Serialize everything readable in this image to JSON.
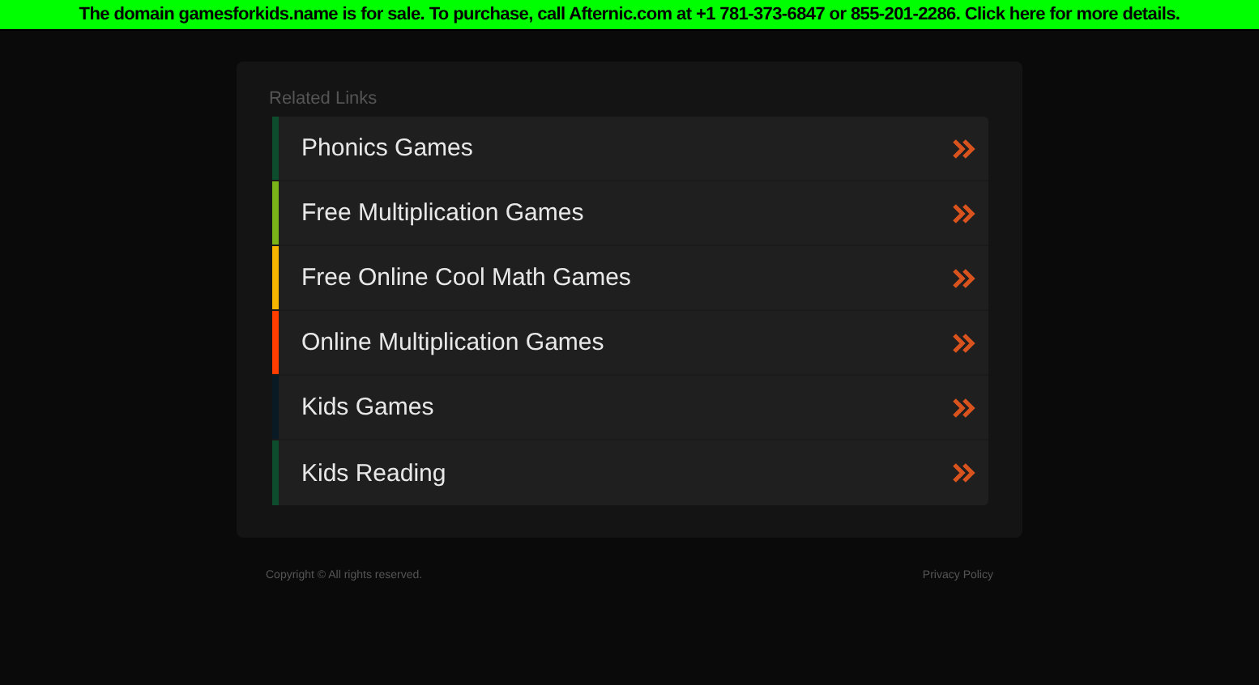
{
  "banner": {
    "text": "The domain gamesforkids.name is for sale. To purchase, call Afternic.com at +1 781-373-6847 or 855-201-2286. Click here for more details."
  },
  "panel": {
    "heading": "Related Links",
    "links": [
      {
        "label": "Phonics Games",
        "color": "#0d4d2e"
      },
      {
        "label": "Free Multiplication Games",
        "color": "#7ab317"
      },
      {
        "label": "Free Online Cool Math Games",
        "color": "#f5b400"
      },
      {
        "label": "Online Multiplication Games",
        "color": "#ff3d00"
      },
      {
        "label": "Kids Games",
        "color": "#0a1a24"
      },
      {
        "label": "Kids Reading",
        "color": "#0d4d2e"
      }
    ]
  },
  "footer": {
    "copyright": "Copyright ©  All rights reserved.",
    "privacy": "Privacy Policy"
  }
}
